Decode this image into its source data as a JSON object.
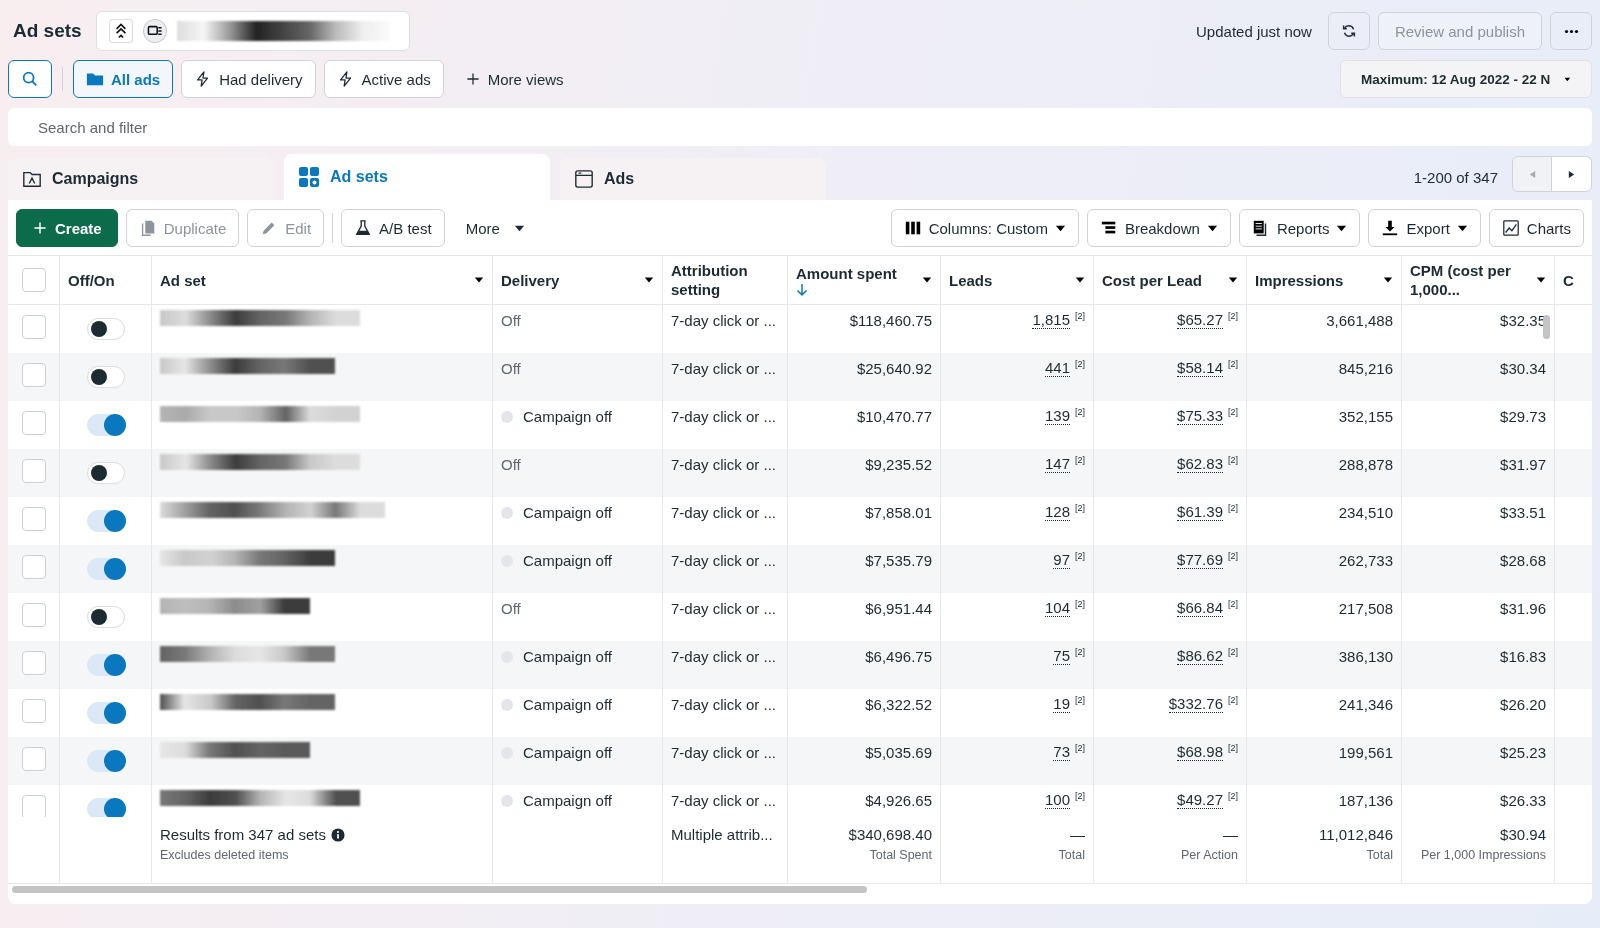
{
  "header": {
    "title": "Ad sets",
    "updated": "Updated just now",
    "publish_button": {
      "label": "Review and publish",
      "disabled": true
    }
  },
  "views": [
    {
      "label": "All ads",
      "selected": true
    },
    {
      "label": "Had delivery",
      "selected": false
    },
    {
      "label": "Active ads",
      "selected": false
    }
  ],
  "more_views": "More views",
  "date_range": "Maximum: 12 Aug 2022 - 22 N",
  "search": {
    "placeholder": "Search and filter"
  },
  "tabs": [
    {
      "label": "Campaigns",
      "selected": false
    },
    {
      "label": "Ad sets",
      "selected": true
    },
    {
      "label": "Ads",
      "selected": false
    }
  ],
  "pagination": "1-200 of 347",
  "toolbar_left": [
    {
      "label": "Create",
      "kind": "primary",
      "disabled": false,
      "dropdown": false
    },
    {
      "label": "Duplicate",
      "kind": "plain",
      "disabled": true,
      "dropdown": false
    },
    {
      "label": "Edit",
      "kind": "plain",
      "disabled": true,
      "dropdown": false
    },
    {
      "label": "A/B test",
      "kind": "plain",
      "disabled": false,
      "dropdown": false
    },
    {
      "label": "More",
      "kind": "ghost",
      "disabled": false,
      "dropdown": true
    }
  ],
  "toolbar_right": [
    {
      "label": "Columns: Custom",
      "dropdown": true
    },
    {
      "label": "Breakdown",
      "dropdown": true
    },
    {
      "label": "Reports",
      "dropdown": true
    },
    {
      "label": "Export",
      "dropdown": true
    },
    {
      "label": "Charts",
      "dropdown": false
    }
  ],
  "table": {
    "select_all_checked": false,
    "columns": [
      {
        "label": "Off/On",
        "menu": false,
        "sorted": false
      },
      {
        "label": "Ad set",
        "menu": true,
        "sorted": false
      },
      {
        "label": "Delivery",
        "menu": true,
        "sorted": false
      },
      {
        "label": "Attribution setting",
        "menu": false,
        "sorted": false
      },
      {
        "label": "Amount spent",
        "menu": true,
        "sorted": true
      },
      {
        "label": "Leads",
        "menu": true,
        "sorted": false
      },
      {
        "label": "Cost per Lead",
        "menu": true,
        "sorted": false
      },
      {
        "label": "Impressions",
        "menu": true,
        "sorted": false
      },
      {
        "label": "CPM (cost per 1,000...",
        "menu": true,
        "sorted": false
      },
      {
        "label": "C",
        "menu": false,
        "sorted": false
      }
    ],
    "rows": [
      {
        "checked": false,
        "on": false,
        "delivery": "Off",
        "status_dot": false,
        "attribution": "7-day click or ...",
        "amount": "$118,460.75",
        "leads": "1,815",
        "leads_note": "[2]",
        "cpl": "$65.27",
        "cpl_note": "[2]",
        "impressions": "3,661,488",
        "cpm": "$32.35"
      },
      {
        "checked": false,
        "on": false,
        "delivery": "Off",
        "status_dot": false,
        "attribution": "7-day click or ...",
        "amount": "$25,640.92",
        "leads": "441",
        "leads_note": "[2]",
        "cpl": "$58.14",
        "cpl_note": "[2]",
        "impressions": "845,216",
        "cpm": "$30.34"
      },
      {
        "checked": false,
        "on": true,
        "delivery": "Campaign off",
        "status_dot": true,
        "attribution": "7-day click or ...",
        "amount": "$10,470.77",
        "leads": "139",
        "leads_note": "[2]",
        "cpl": "$75.33",
        "cpl_note": "[2]",
        "impressions": "352,155",
        "cpm": "$29.73"
      },
      {
        "checked": false,
        "on": false,
        "delivery": "Off",
        "status_dot": false,
        "attribution": "7-day click or ...",
        "amount": "$9,235.52",
        "leads": "147",
        "leads_note": "[2]",
        "cpl": "$62.83",
        "cpl_note": "[2]",
        "impressions": "288,878",
        "cpm": "$31.97"
      },
      {
        "checked": false,
        "on": true,
        "delivery": "Campaign off",
        "status_dot": true,
        "attribution": "7-day click or ...",
        "amount": "$7,858.01",
        "leads": "128",
        "leads_note": "[2]",
        "cpl": "$61.39",
        "cpl_note": "[2]",
        "impressions": "234,510",
        "cpm": "$33.51"
      },
      {
        "checked": false,
        "on": true,
        "delivery": "Campaign off",
        "status_dot": true,
        "attribution": "7-day click or ...",
        "amount": "$7,535.79",
        "leads": "97",
        "leads_note": "[2]",
        "cpl": "$77.69",
        "cpl_note": "[2]",
        "impressions": "262,733",
        "cpm": "$28.68"
      },
      {
        "checked": false,
        "on": false,
        "delivery": "Off",
        "status_dot": false,
        "attribution": "7-day click or ...",
        "amount": "$6,951.44",
        "leads": "104",
        "leads_note": "[2]",
        "cpl": "$66.84",
        "cpl_note": "[2]",
        "impressions": "217,508",
        "cpm": "$31.96"
      },
      {
        "checked": false,
        "on": true,
        "delivery": "Campaign off",
        "status_dot": true,
        "attribution": "7-day click or ...",
        "amount": "$6,496.75",
        "leads": "75",
        "leads_note": "[2]",
        "cpl": "$86.62",
        "cpl_note": "[2]",
        "impressions": "386,130",
        "cpm": "$16.83"
      },
      {
        "checked": false,
        "on": true,
        "delivery": "Campaign off",
        "status_dot": true,
        "attribution": "7-day click or ...",
        "amount": "$6,322.52",
        "leads": "19",
        "leads_note": "[2]",
        "cpl": "$332.76",
        "cpl_note": "[2]",
        "impressions": "241,346",
        "cpm": "$26.20"
      },
      {
        "checked": false,
        "on": true,
        "delivery": "Campaign off",
        "status_dot": true,
        "attribution": "7-day click or ...",
        "amount": "$5,035.69",
        "leads": "73",
        "leads_note": "[2]",
        "cpl": "$68.98",
        "cpl_note": "[2]",
        "impressions": "199,561",
        "cpm": "$25.23"
      },
      {
        "checked": false,
        "on": true,
        "delivery": "Campaign off",
        "status_dot": true,
        "attribution": "7-day click or ...",
        "amount": "$4,926.65",
        "leads": "100",
        "leads_note": "[2]",
        "cpl": "$49.27",
        "cpl_note": "[2]",
        "impressions": "187,136",
        "cpm": "$26.33"
      }
    ],
    "footer": {
      "results": "Results from 347 ad sets",
      "excludes": "Excludes deleted items",
      "attribution": "Multiple attrib...",
      "totals": [
        {
          "value": "$340,698.40",
          "label": "Total Spent"
        },
        {
          "value": "—",
          "label": "Total"
        },
        {
          "value": "—",
          "label": "Per Action"
        },
        {
          "value": "11,012,846",
          "label": "Total"
        },
        {
          "value": "$30.94",
          "label": "Per 1,000 Impressions"
        }
      ]
    }
  }
}
